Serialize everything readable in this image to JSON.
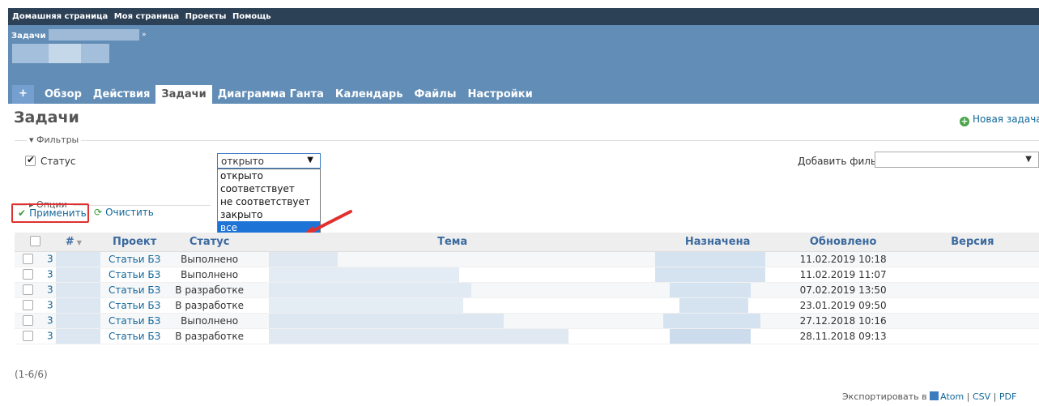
{
  "top_menu": [
    "Домашняя страница",
    "Моя страница",
    "Проекты",
    "Помощь"
  ],
  "header": {
    "project_title": "Задачи",
    "title_arrow": "»"
  },
  "tabs": [
    {
      "label": "+",
      "selected": false
    },
    {
      "label": "Обзор",
      "selected": false
    },
    {
      "label": "Действия",
      "selected": false
    },
    {
      "label": "Задачи",
      "selected": true
    },
    {
      "label": "Диаграмма Ганта",
      "selected": false
    },
    {
      "label": "Календарь",
      "selected": false
    },
    {
      "label": "Файлы",
      "selected": false
    },
    {
      "label": "Настройки",
      "selected": false
    }
  ],
  "page_title": "Задачи",
  "new_issue_label": "Новая задача",
  "filters": {
    "legend": "Фильтры",
    "status_label": "Статус",
    "status_checked": true,
    "status_select_value": "открыто",
    "status_options": [
      "открыто",
      "соответствует",
      "не соответствует",
      "закрыто",
      "все"
    ],
    "status_highlighted": "все",
    "add_filter_label": "Добавить фильтр",
    "add_filter_value": ""
  },
  "options_legend": "Опции",
  "apply_label": "Применить",
  "clear_label": "Очистить",
  "table": {
    "columns": [
      "#",
      "Проект",
      "Статус",
      "Тема",
      "Назначена",
      "Обновлено",
      "Версия"
    ],
    "rows": [
      {
        "id": "3",
        "project": "Статьи БЗ",
        "status": "Выполнено",
        "updated": "11.02.2019 10:18"
      },
      {
        "id": "3",
        "project": "Статьи БЗ",
        "status": "Выполнено",
        "updated": "11.02.2019 11:07"
      },
      {
        "id": "3",
        "project": "Статьи БЗ",
        "status": "В разработке",
        "updated": "07.02.2019 13:50"
      },
      {
        "id": "3",
        "project": "Статьи БЗ",
        "status": "В разработке",
        "updated": "23.01.2019 09:50"
      },
      {
        "id": "3",
        "project": "Статьи БЗ",
        "status": "Выполнено",
        "updated": "27.12.2018 10:16"
      },
      {
        "id": "3",
        "project": "Статьи БЗ",
        "status": "В разработке",
        "updated": "28.11.2018 09:13"
      }
    ]
  },
  "pagination": "(1-6/6)",
  "export": {
    "label": "Экспортировать в",
    "atom": "Atom",
    "csv": "CSV",
    "pdf": "PDF",
    "sep": "|"
  },
  "colors": {
    "accent": "#628DB6",
    "top_bar": "#2C4056",
    "link": "#116699",
    "highlight_box": "#e03030",
    "arrow": "#e03030"
  }
}
